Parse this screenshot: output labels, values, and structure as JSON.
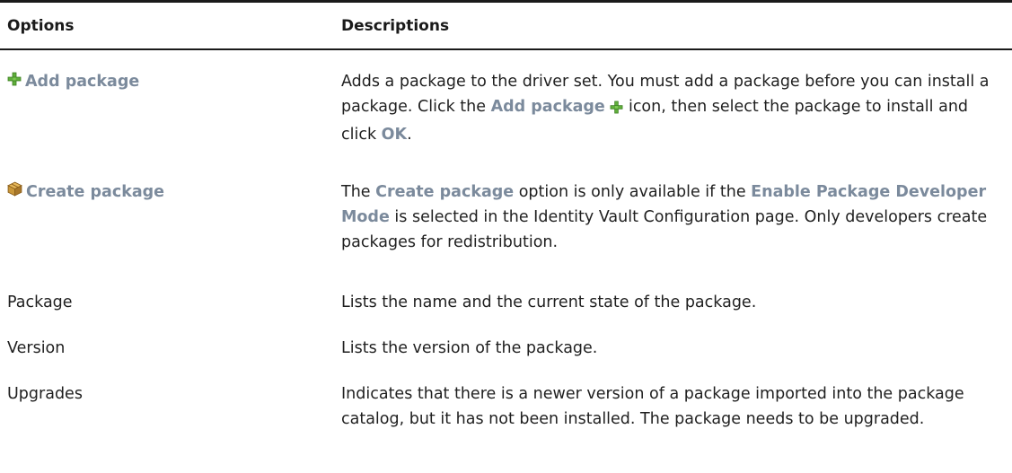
{
  "table": {
    "headers": {
      "options": "Options",
      "descriptions": "Descriptions"
    },
    "rows": [
      {
        "option": "Add package",
        "option_icon": "plus-icon",
        "desc_part1": "Adds a package to the driver set. You must add a package before you can install a package. Click the ",
        "desc_term1": "Add package",
        "desc_part2": " icon, then select the package to install and click ",
        "desc_term2": "OK",
        "desc_part3": "."
      },
      {
        "option": "Create package",
        "option_icon": "package-icon",
        "desc_part1": "The ",
        "desc_term1": "Create package",
        "desc_part2": " option is only available if the ",
        "desc_term2": "Enable Package Developer Mode",
        "desc_part3": " is selected in the Identity Vault Configuration page. Only developers create packages for redistribution."
      },
      {
        "option": "Package",
        "description": "Lists the name and the current state of the package."
      },
      {
        "option": "Version",
        "description": "Lists the version of the package."
      },
      {
        "option": "Upgrades",
        "description": "Indicates that there is a newer version of a package imported into the package catalog, but it has not been installed. The package needs to be upgraded."
      }
    ]
  },
  "colors": {
    "ui_term": "#7b8a9c",
    "plus_icon": "#5fae3a",
    "package_icon": "#c9973a"
  }
}
